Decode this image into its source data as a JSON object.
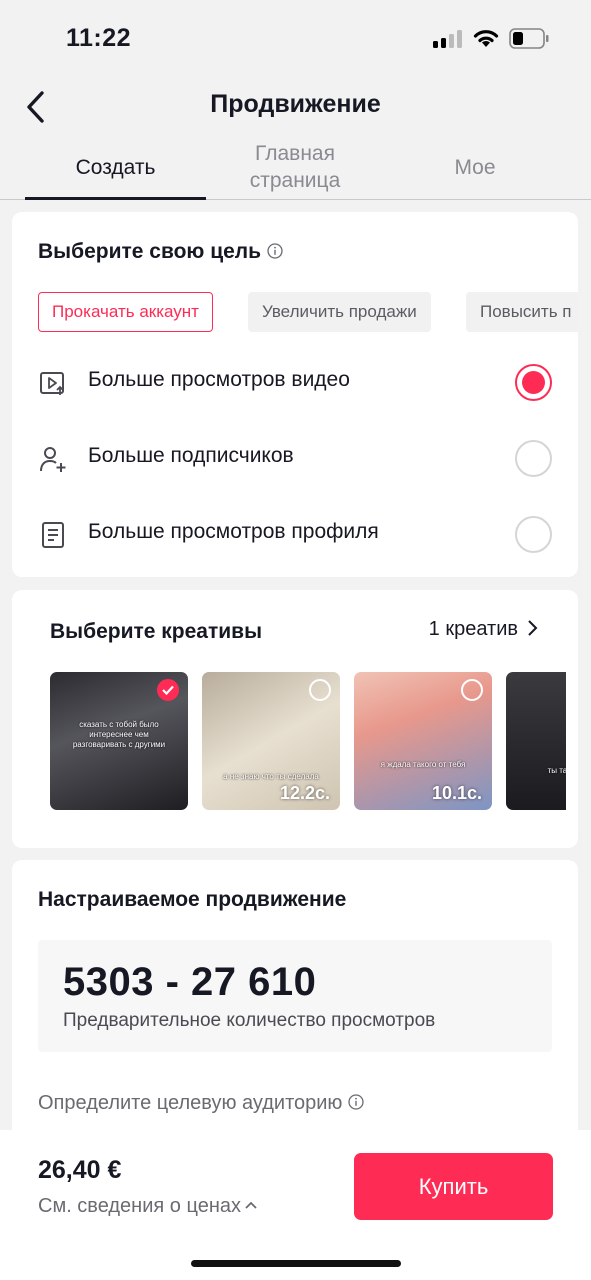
{
  "status_bar": {
    "time": "11:22"
  },
  "header": {
    "title": "Продвижение",
    "tabs": [
      {
        "label": "Создать"
      },
      {
        "label": "Главная страница"
      },
      {
        "label": "Мое"
      }
    ]
  },
  "goal": {
    "title": "Выберите свою цель",
    "chips": [
      {
        "label": "Прокачать аккаунт"
      },
      {
        "label": "Увеличить продажи"
      },
      {
        "label": "Повысить п"
      }
    ],
    "options": [
      {
        "label": "Больше просмотров видео",
        "icon": "video-views-icon",
        "selected": true
      },
      {
        "label": "Больше подписчиков",
        "icon": "add-follower-icon",
        "selected": false
      },
      {
        "label": "Больше просмотров профиля",
        "icon": "profile-page-icon",
        "selected": false
      }
    ]
  },
  "creatives": {
    "title": "Выберите креативы",
    "count_label": "1 креатив",
    "thumbs": [
      {
        "selected": true,
        "duration": "",
        "caption": "сказать с тобой было интереснее чем разговаривать с другими"
      },
      {
        "selected": false,
        "duration": "12.2с.",
        "caption": "а не знаю что ты сделала"
      },
      {
        "selected": false,
        "duration": "10.1с.",
        "caption": "я ждала такого от тебя"
      },
      {
        "selected": false,
        "duration": "",
        "caption": "ты так красива"
      }
    ]
  },
  "custom": {
    "title": "Настраиваемое продвижение",
    "estimate_range": "5303 - 27 610",
    "estimate_label": "Предварительное количество просмотров",
    "audience_label": "Определите целевую аудиторию"
  },
  "footer": {
    "price": "26,40 €",
    "price_details": "См. сведения о ценах",
    "buy_label": "Купить"
  },
  "colors": {
    "accent": "#fe2c55",
    "text": "#161823",
    "muted": "#8a8b91"
  }
}
